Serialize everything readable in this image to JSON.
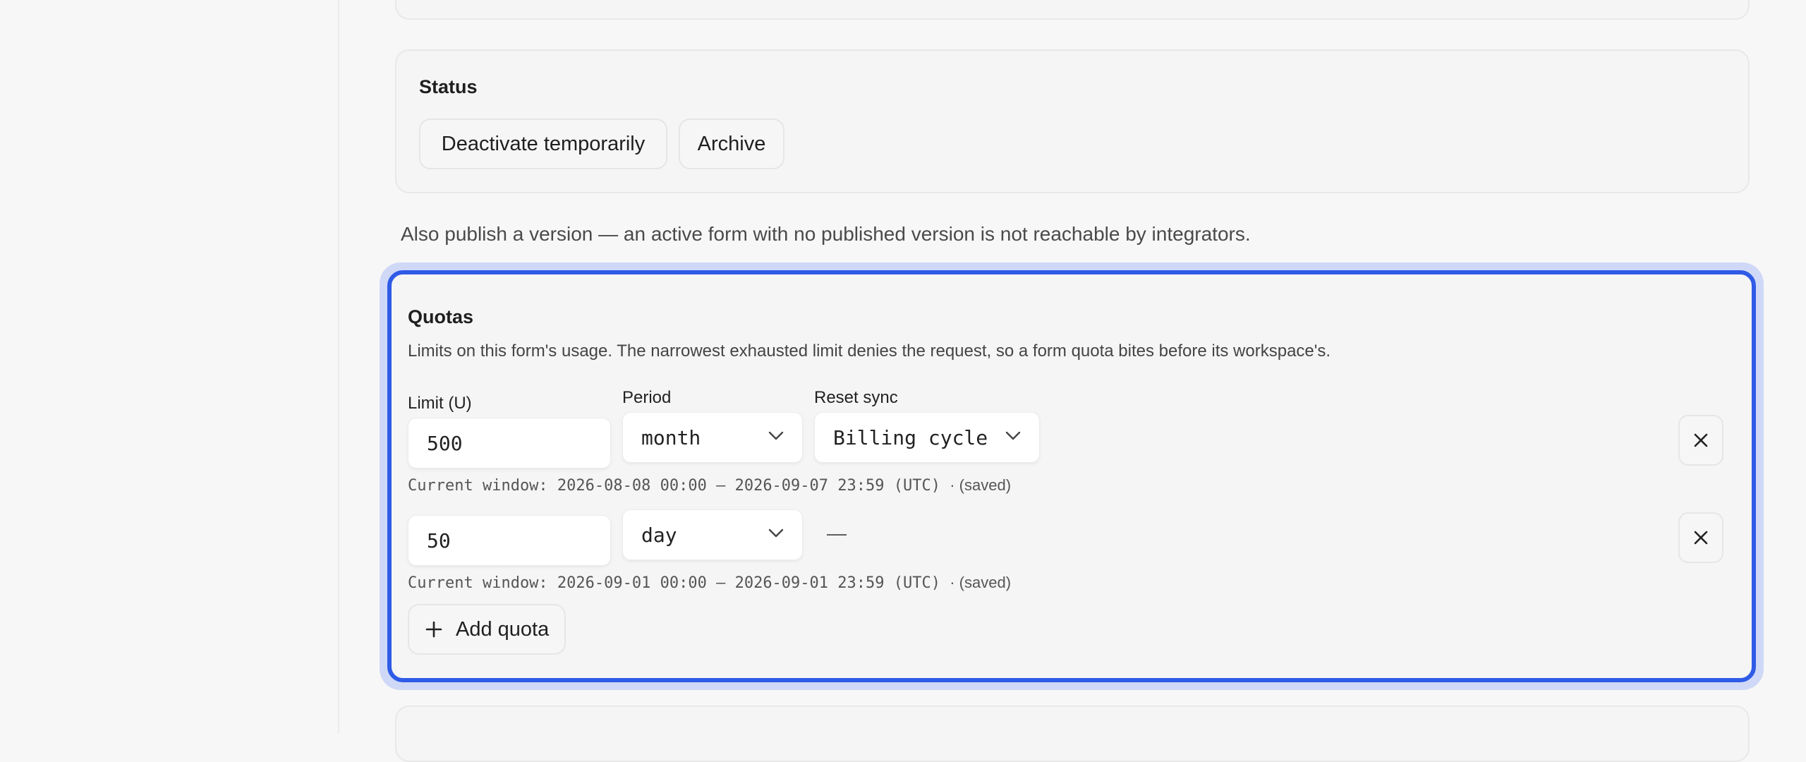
{
  "status": {
    "title": "Status",
    "deactivate_label": "Deactivate temporarily",
    "archive_label": "Archive"
  },
  "publish_note": "Also publish a version — an active form with no published version is not reachable by integrators.",
  "quotas": {
    "title": "Quotas",
    "description": "Limits on this form's usage. The narrowest exhausted limit denies the request, so a form quota bites before its workspace's.",
    "labels": {
      "limit": "Limit (U)",
      "period": "Period",
      "reset_sync": "Reset sync"
    },
    "rows": [
      {
        "limit": "500",
        "period": "month",
        "reset_sync": "Billing cycle",
        "window": "Current window: 2026-08-08 00:00 – 2026-09-07 23:59 (UTC)",
        "saved": "· (saved)"
      },
      {
        "limit": "50",
        "period": "day",
        "reset_sync": "—",
        "window": "Current window: 2026-09-01 00:00 – 2026-09-01 23:59 (UTC)",
        "saved": "· (saved)"
      }
    ],
    "add_label": "Add quota"
  },
  "icons": {
    "remove": "close-icon",
    "dropdown": "chevron-down-icon",
    "add": "plus-icon"
  },
  "colors": {
    "focus_ring": "#2f5be6",
    "focus_halo": "#cfd8f7",
    "page_bg": "#f7f7f7"
  }
}
